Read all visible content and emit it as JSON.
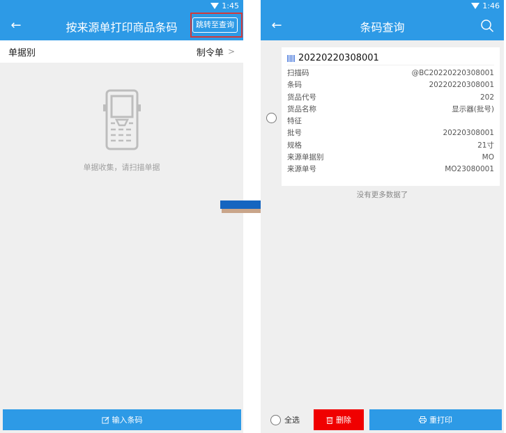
{
  "left": {
    "status_time": "1:45",
    "back_glyph": "←",
    "title": "按来源单打印商品条码",
    "jump_label": "跳转至查询",
    "doc_type_label": "单据别",
    "doc_type_value": "制令单",
    "empty_hint": "单据收集，请扫描单据",
    "input_barcode_label": "输入条码",
    "icons": {
      "back": "back-arrow-icon",
      "device": "scanner-device-icon",
      "edit": "edit-icon",
      "chevron": "chevron-right-icon"
    }
  },
  "right": {
    "status_time": "1:46",
    "back_glyph": "←",
    "title": "条码查询",
    "card": {
      "header": "20220220308001",
      "fields": [
        {
          "label": "扫描码",
          "value": "@BC20220220308001"
        },
        {
          "label": "条码",
          "value": "20220220308001"
        },
        {
          "label": "货品代号",
          "value": "202"
        },
        {
          "label": "货品名称",
          "value": "显示器(批号)"
        },
        {
          "label": "特征",
          "value": ""
        },
        {
          "label": "批号",
          "value": "20220308001"
        },
        {
          "label": "规格",
          "value": "21寸"
        },
        {
          "label": "来源单据别",
          "value": "MO"
        },
        {
          "label": "来源单号",
          "value": "MO23080001"
        }
      ]
    },
    "no_more": "没有更多数据了",
    "select_all_label": "全选",
    "delete_label": "删除",
    "reprint_label": "重打印",
    "icons": {
      "search": "search-icon",
      "barcode": "barcode-icon",
      "delete": "trash-icon",
      "print": "printer-icon"
    }
  },
  "colors": {
    "primary": "#2d9ae6",
    "danger": "#f00000",
    "highlight": "#d23a3a",
    "arrow": "#1565c0",
    "arrow_shadow": "#c9a58a"
  }
}
